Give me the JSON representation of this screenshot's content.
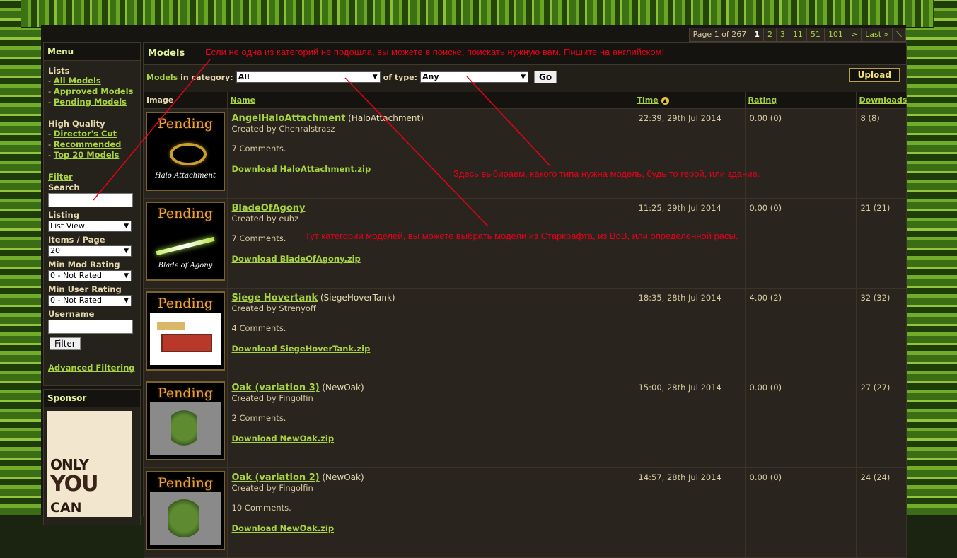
{
  "pager": {
    "info": "Page 1 of 267",
    "current": "1",
    "links": [
      "2",
      "3",
      "11",
      "51",
      "101",
      ">",
      "Last »",
      "⟍"
    ]
  },
  "sidebar": {
    "menu_title": "Menu",
    "lists_heading": "Lists",
    "lists": [
      "All Models",
      "Approved Models",
      "Pending Models"
    ],
    "hq_heading": "High Quality",
    "hq": [
      "Director's Cut",
      "Recommended",
      "Top 20 Models"
    ],
    "filter_link": "Filter",
    "search_label": "Search",
    "search_value": "",
    "listing_label": "Listing",
    "listing_value": "List View",
    "items_label": "Items / Page",
    "items_value": "20",
    "min_mod_label": "Min Mod Rating",
    "min_mod_value": "0 - Not Rated",
    "min_user_label": "Min User Rating",
    "min_user_value": "0 - Not Rated",
    "username_label": "Username",
    "username_value": "",
    "filter_button": "Filter",
    "advanced_link": "Advanced Filtering",
    "sponsor_title": "Sponsor",
    "ad_lines": [
      "ONLY",
      "YOU",
      "CAN"
    ]
  },
  "main": {
    "title": "Models",
    "models_link": "Models",
    "in_category": "in category:",
    "category_value": "All",
    "of_type": "of type:",
    "type_value": "Any",
    "go_button": "Go",
    "upload_button": "Upload",
    "columns": [
      "Image",
      "Name",
      "Time",
      "Rating",
      "Downloads"
    ],
    "rows": [
      {
        "name": "AngelHaloAttachment",
        "file": "(HaloAttachment)",
        "author": "Created by Chenralstrasz",
        "comments": "7 Comments.",
        "download": "Download HaloAttachment.zip",
        "time": "22:39, 29th Jul 2014",
        "rating": "0.00 (0)",
        "downloads": "8 (8)",
        "thumb_label": "Pending",
        "thumb_caption": "Halo Attachment"
      },
      {
        "name": "BladeOfAgony",
        "file": "",
        "author": "Created by eubz",
        "comments": "7 Comments.",
        "download": "Download BladeOfAgony.zip",
        "time": "11:25, 29th Jul 2014",
        "rating": "0.00 (0)",
        "downloads": "21 (21)",
        "thumb_label": "Pending",
        "thumb_caption": "Blade of Agony"
      },
      {
        "name": "Siege Hovertank",
        "file": "(SiegeHoverTank)",
        "author": "Created by Strenyoff",
        "comments": "4 Comments.",
        "download": "Download SiegeHoverTank.zip",
        "time": "18:35, 28th Jul 2014",
        "rating": "4.00 (2)",
        "downloads": "32 (32)",
        "thumb_label": "Pending",
        "thumb_caption": ""
      },
      {
        "name": "Oak (variation 3)",
        "file": "(NewOak)",
        "author": "Created by Fingolfin",
        "comments": "2 Comments.",
        "download": "Download NewOak.zip",
        "time": "15:00, 28th Jul 2014",
        "rating": "0.00 (0)",
        "downloads": "27 (27)",
        "thumb_label": "Pending",
        "thumb_caption": ""
      },
      {
        "name": "Oak (variation 2)",
        "file": "(NewOak)",
        "author": "Created by Fingolfin",
        "comments": "10 Comments.",
        "download": "Download NewOak.zip",
        "time": "14:57, 28th Jul 2014",
        "rating": "0.00 (0)",
        "downloads": "24 (24)",
        "thumb_label": "Pending",
        "thumb_caption": ""
      }
    ]
  },
  "annotations": {
    "search_note": "Если не одна из категорий не подошла, вы можете в поиске, поискать нужную вам. Пишите на английском!",
    "type_note": "Здесь выбираем, какого типа нужна модель, будь то герой, или здание.",
    "category_note": "Тут категории моделей, вы можете выбрать модели из Старкрафта, из ВоВ, или определенной расы."
  },
  "colors": {
    "link": "#a6d33f",
    "annotation": "#e8001a",
    "background": "#171512"
  }
}
